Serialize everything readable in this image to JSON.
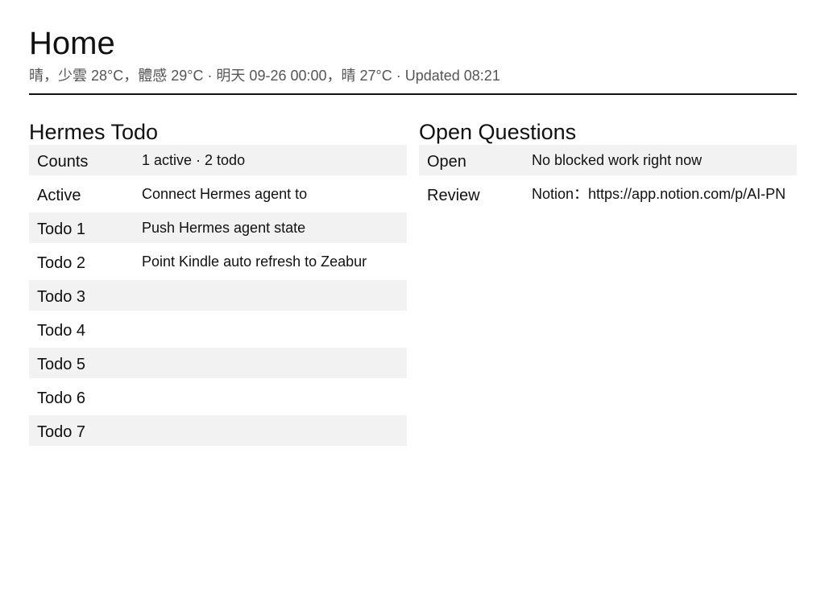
{
  "header": {
    "title": "Home",
    "subtitle": "晴，少雲 28°C，體感 29°C · 明天 09-26 00:00，晴 27°C · Updated 08:21"
  },
  "todo": {
    "title": "Hermes Todo",
    "rows": [
      {
        "label": "Counts",
        "value": "1 active · 2 todo"
      },
      {
        "label": "Active",
        "value": "Connect Hermes agent to"
      },
      {
        "label": "Todo 1",
        "value": "Push Hermes agent state"
      },
      {
        "label": "Todo 2",
        "value": "Point Kindle auto refresh to Zeabur"
      },
      {
        "label": "Todo 3",
        "value": ""
      },
      {
        "label": "Todo 4",
        "value": ""
      },
      {
        "label": "Todo 5",
        "value": ""
      },
      {
        "label": "Todo 6",
        "value": ""
      },
      {
        "label": "Todo 7",
        "value": ""
      }
    ]
  },
  "questions": {
    "title": "Open Questions",
    "rows": [
      {
        "label": "Open",
        "value": "No blocked work right now"
      },
      {
        "label": "Review",
        "value": "Notion：https://app.notion.com/p/AI-PN"
      }
    ]
  }
}
